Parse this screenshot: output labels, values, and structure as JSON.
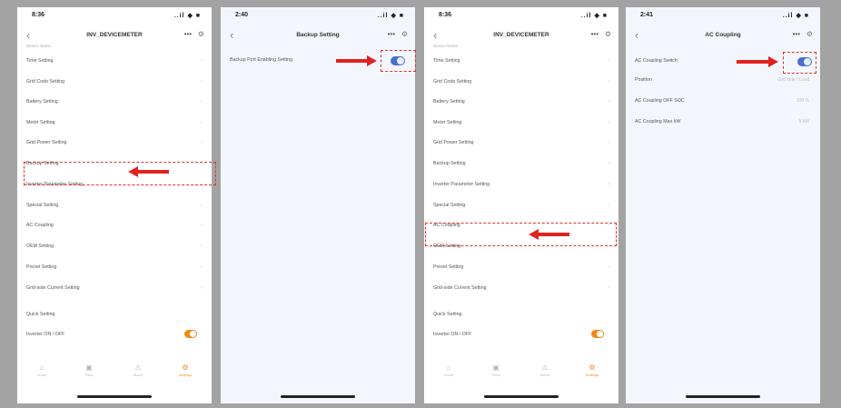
{
  "screens": [
    {
      "time": "8:36",
      "signal": "..il ◆ ■",
      "title": "INV_DEVICEMETER",
      "subtitle": "Device Name",
      "items": [
        "Time Setting",
        "Grid Code Setting",
        "Battery Setting",
        "Meter Setting",
        "Grid Power Setting",
        "Backup Setting",
        "Inverter Parameter Setting",
        "Special Setting",
        "AC Coupling",
        "OEM Setting",
        "Preset Setting",
        "Grid-side Current Setting"
      ],
      "extra_item": "Quick Setting",
      "toggle_item": "Inverter ON / OFF",
      "tabs": [
        "Home",
        "Plant",
        "Alarm",
        "Settings"
      ]
    },
    {
      "time": "2:40",
      "signal": "..il ◆ ■",
      "title": "Backup Setting",
      "items": [
        "Backup Port Enabling Setting"
      ]
    },
    {
      "time": "8:36",
      "signal": "..il ◆ ■",
      "title": "INV_DEVICEMETER",
      "subtitle": "Device Name",
      "items": [
        "Time Setting",
        "Grid Code Setting",
        "Battery Setting",
        "Meter Setting",
        "Grid Power Setting",
        "Backup Setting",
        "Inverter Parameter Setting",
        "Special Setting",
        "AC Coupling",
        "OEM Setting",
        "Preset Setting",
        "Grid-side Current Setting"
      ],
      "extra_item": "Quick Setting",
      "toggle_item": "Inverter ON / OFF",
      "tabs": [
        "Home",
        "Plant",
        "Alarm",
        "Settings"
      ]
    },
    {
      "time": "2:41",
      "signal": "..il ◆ ■",
      "title": "AC Coupling",
      "items": [
        {
          "label": "AC Coupling Switch",
          "value": ""
        },
        {
          "label": "Position",
          "value": "Grid side / Load"
        },
        {
          "label": "AC Coupling OFF SOC",
          "value": "100 %"
        },
        {
          "label": "AC Coupling Max kW",
          "value": "5 kW"
        }
      ]
    }
  ],
  "colors": {
    "accent": "#f08a1e",
    "toggle_blue": "#4a6fc9",
    "annotation_red": "#e1231f"
  }
}
